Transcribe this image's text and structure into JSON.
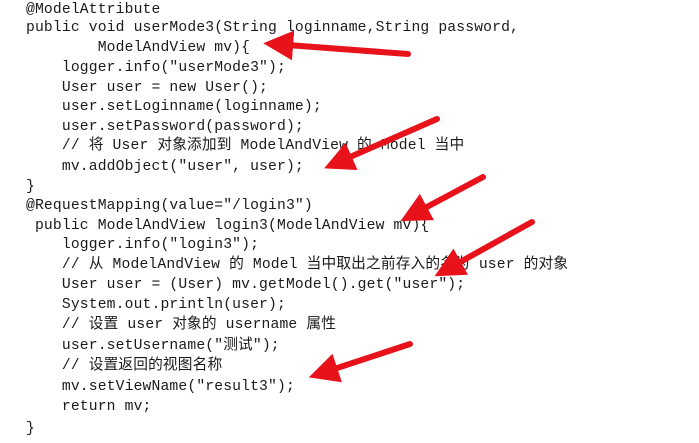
{
  "code": {
    "lines": [
      {
        "text": "@ModelAttribute"
      },
      {
        "text": "public void userMode3(String loginname,String password,"
      },
      {
        "text": "        ModelAndView mv){"
      },
      {
        "text": "    logger.info(\"userMode3\");"
      },
      {
        "text": "    User user = new User();"
      },
      {
        "text": "    user.setLoginname(loginname);"
      },
      {
        "text": "    user.setPassword(password);"
      },
      {
        "text": "    // 将 User 对象添加到 ModelAndView 的 Model 当中"
      },
      {
        "text": "    mv.addObject(\"user\", user);"
      },
      {
        "text": "}"
      },
      {
        "text": "@RequestMapping(value=\"/login3\")"
      },
      {
        "text": " public ModelAndView login3(ModelAndView mv){"
      },
      {
        "text": "    logger.info(\"login3\");"
      },
      {
        "text": "    // 从 ModelAndView 的 Model 当中取出之前存入的名为 user 的对象"
      },
      {
        "text": "    User user = (User) mv.getModel().get(\"user\");"
      },
      {
        "text": "    System.out.println(user);"
      },
      {
        "text": "    // 设置 user 对象的 username 属性"
      },
      {
        "text": "    user.setUsername(\"测试\");"
      },
      {
        "text": "    // 设置返回的视图名称"
      },
      {
        "text": "    mv.setViewName(\"result3\");"
      },
      {
        "text": "    return mv;"
      },
      {
        "text": "}"
      }
    ]
  },
  "annotations": {
    "arrow_color": "#e8121b",
    "arrow_count": 6
  }
}
